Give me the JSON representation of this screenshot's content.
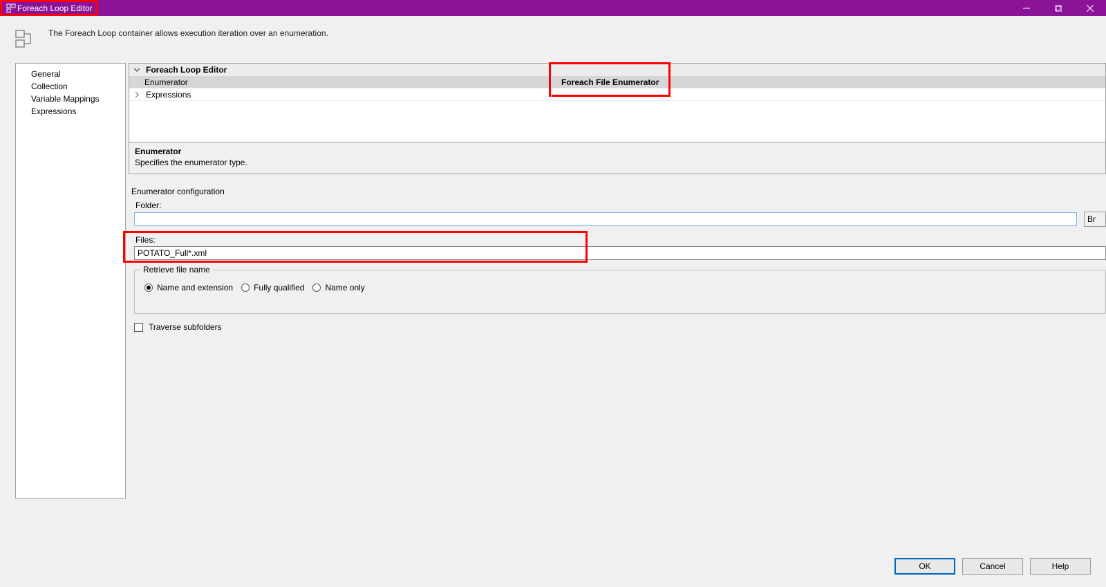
{
  "window": {
    "title": "Foreach Loop Editor"
  },
  "description": "The Foreach Loop container allows execution iteration over an enumeration.",
  "sidebar": {
    "items": [
      {
        "label": "General"
      },
      {
        "label": "Collection"
      },
      {
        "label": "Variable Mappings"
      },
      {
        "label": "Expressions"
      }
    ]
  },
  "propgrid": {
    "header": "Foreach Loop Editor",
    "rows": [
      {
        "name": "Enumerator",
        "value": "Foreach File Enumerator"
      },
      {
        "name": "Expressions",
        "value": ""
      }
    ],
    "help_title": "Enumerator",
    "help_desc": "Specifies the enumerator type."
  },
  "enum_config": {
    "section_label": "Enumerator configuration",
    "folder_label": "Folder:",
    "folder_value": "",
    "browse_label": "Br",
    "files_label": "Files:",
    "files_value": "POTATO_Full*.xml"
  },
  "retrieve": {
    "legend": "Retrieve file name",
    "options": {
      "name_ext": "Name and extension",
      "fully": "Fully qualified",
      "name_only": "Name only"
    },
    "selected": "name_ext"
  },
  "traverse_label": "Traverse subfolders",
  "buttons": {
    "ok": "OK",
    "cancel": "Cancel",
    "help": "Help"
  }
}
